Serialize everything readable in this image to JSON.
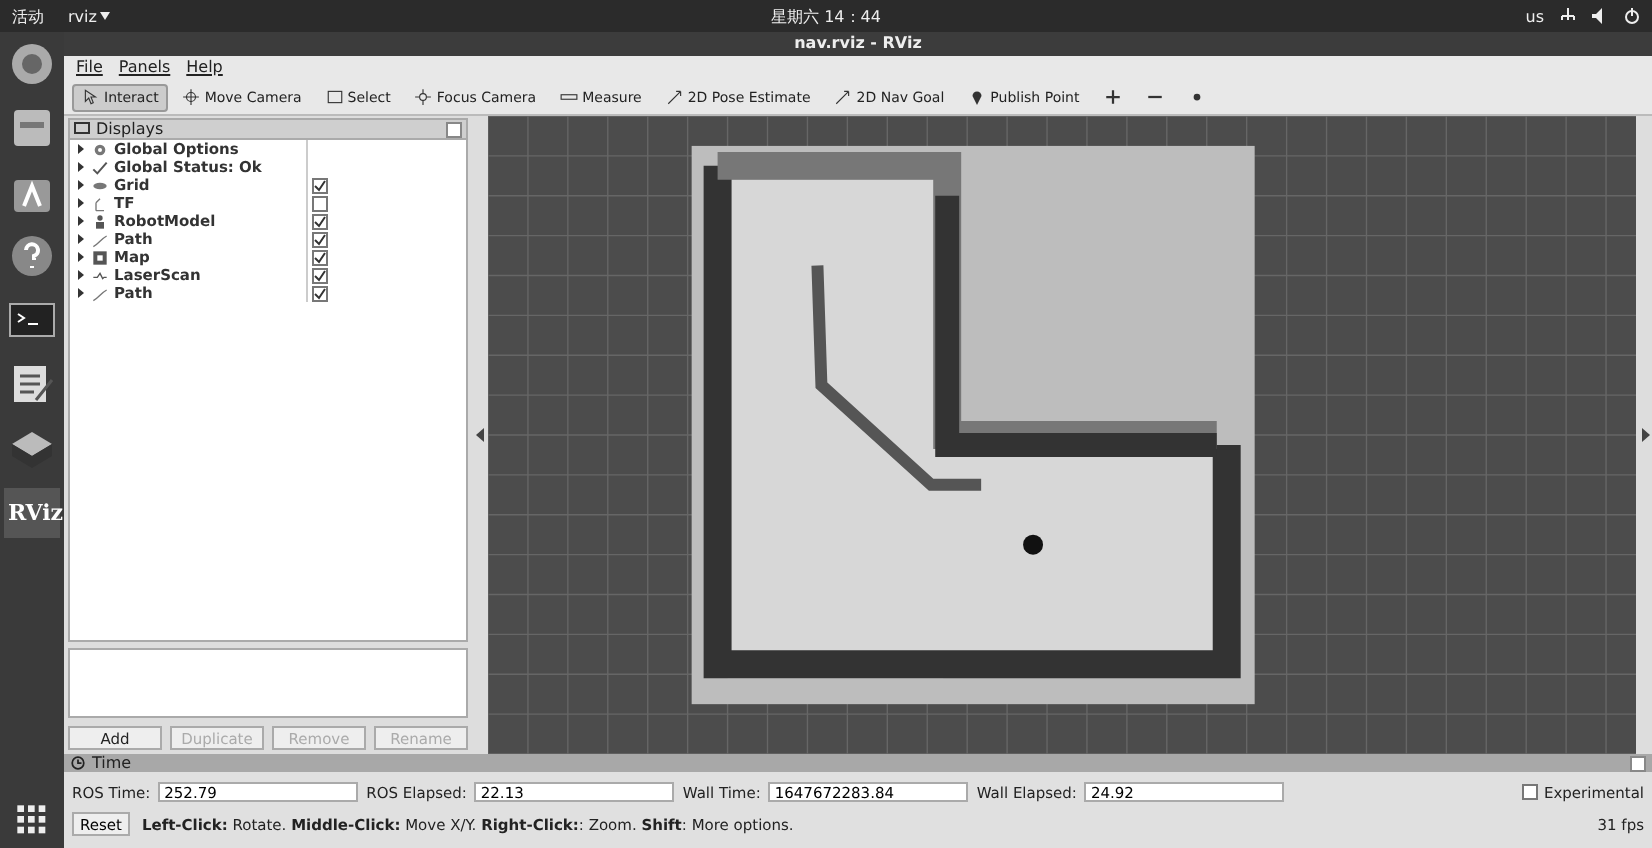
{
  "top_bar": {
    "activities": "活动",
    "app_menu": "rviz",
    "clock": "星期六 14：44",
    "keyboard": "us"
  },
  "dock": {
    "items": [
      {
        "kind": "browser"
      },
      {
        "kind": "files"
      },
      {
        "kind": "store"
      },
      {
        "kind": "help"
      },
      {
        "kind": "terminal"
      },
      {
        "kind": "editor"
      },
      {
        "kind": "layers"
      },
      {
        "kind": "rviz",
        "label": "RViz"
      }
    ]
  },
  "window": {
    "title": "nav.rviz - RViz"
  },
  "menu": [
    "File",
    "Panels",
    "Help"
  ],
  "toolbar": [
    {
      "label": "Interact",
      "kind": "cursor",
      "selected": true
    },
    {
      "label": "Move Camera",
      "kind": "move",
      "selected": false
    },
    {
      "label": "Select",
      "kind": "select",
      "selected": false
    },
    {
      "label": "Focus Camera",
      "kind": "focus",
      "selected": false
    },
    {
      "label": "Measure",
      "kind": "ruler",
      "selected": false
    },
    {
      "label": "2D Pose Estimate",
      "kind": "arrow",
      "selected": false
    },
    {
      "label": "2D Nav Goal",
      "kind": "arrow",
      "selected": false
    },
    {
      "label": "Publish Point",
      "kind": "pin",
      "selected": false
    },
    {
      "kind": "plus",
      "selected": false
    },
    {
      "kind": "minus",
      "selected": false
    },
    {
      "kind": "eye",
      "selected": false
    }
  ],
  "displays": {
    "title": "Displays",
    "items": [
      {
        "label": "Global Options",
        "kind": "gear"
      },
      {
        "label": "Global Status: Ok",
        "kind": "check"
      },
      {
        "label": "Grid",
        "kind": "grid",
        "checked": true
      },
      {
        "label": "TF",
        "kind": "tf",
        "checked": false
      },
      {
        "label": "RobotModel",
        "kind": "robot",
        "checked": true
      },
      {
        "label": "Path",
        "kind": "path",
        "checked": true
      },
      {
        "label": "Map",
        "kind": "map",
        "checked": true
      },
      {
        "label": "LaserScan",
        "kind": "scan",
        "checked": true
      },
      {
        "label": "Path",
        "kind": "path",
        "checked": true
      }
    ],
    "buttons": [
      {
        "label": "Add",
        "disabled": false
      },
      {
        "label": "Duplicate",
        "disabled": true
      },
      {
        "label": "Remove",
        "disabled": true
      },
      {
        "label": "Rename",
        "disabled": true
      }
    ]
  },
  "time": {
    "title": "Time",
    "fields": [
      {
        "label": "ROS Time:",
        "value": "252.79"
      },
      {
        "label": "ROS Elapsed:",
        "value": "22.13"
      },
      {
        "label": "Wall Time:",
        "value": "1647672283.84"
      },
      {
        "label": "Wall Elapsed:",
        "value": "24.92"
      }
    ],
    "experimental": {
      "label": "Experimental",
      "checked": false
    }
  },
  "status_bar": {
    "reset": "Reset",
    "help": "**Left-Click:** Rotate. **Middle-Click:** Move X/Y. **Right-Click:**: Zoom. **Shift**: More options.",
    "fps": "31 fps"
  }
}
